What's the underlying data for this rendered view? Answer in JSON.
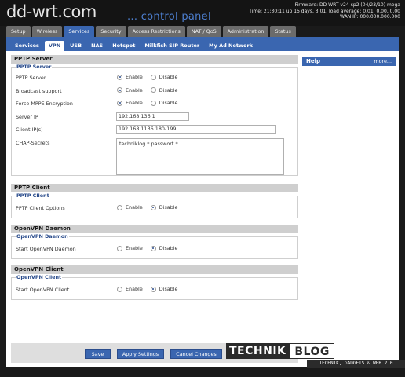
{
  "header": {
    "logo": "dd-wrt.com",
    "panel": "... control panel",
    "firmware": "Firmware: DD-WRT v24-sp2 (04/23/10) mega",
    "time": "Time: 21:30:11 up 15 days, 3:01, load average: 0.01, 0.00, 0.00",
    "wan_ip": "WAN IP: 000.000.000.000"
  },
  "tabs": [
    "Setup",
    "Wireless",
    "Services",
    "Security",
    "Access Restrictions",
    "NAT / QoS",
    "Administration",
    "Status"
  ],
  "subtabs": [
    "Services",
    "VPN",
    "USB",
    "NAS",
    "Hotspot",
    "Milkfish SIP Router",
    "My Ad Network"
  ],
  "options": {
    "enable": "Enable",
    "disable": "Disable"
  },
  "pptp_server": {
    "title": "PPTP Server",
    "legend": "PPTP Server",
    "pptp_server_label": "PPTP Server",
    "broadcast_label": "Broadcast support",
    "mppe_label": "Force MPPE Encryption",
    "server_ip_label": "Server IP",
    "server_ip_value": "192.168.136.1",
    "client_ips_label": "Client IP(s)",
    "client_ips_value": "192.168.1136.180-199",
    "chap_label": "CHAP-Secrets",
    "chap_value": "techniklog * passwort *"
  },
  "pptp_client": {
    "title": "PPTP Client",
    "legend": "PPTP Client",
    "options_label": "PPTP Client Options"
  },
  "openvpn_daemon": {
    "title": "OpenVPN Daemon",
    "legend": "OpenVPN Daemon",
    "start_label": "Start OpenVPN Daemon"
  },
  "openvpn_client": {
    "title": "OpenVPN Client",
    "legend": "OpenVPN Client",
    "start_label": "Start OpenVPN Client"
  },
  "help": {
    "title": "Help",
    "more": "more..."
  },
  "buttons": {
    "save": "Save",
    "apply": "Apply Settings",
    "cancel": "Cancel Changes"
  },
  "watermark": {
    "part1": "TECHNIK",
    "part2": "BLOG",
    "tagline": "TECHNIK, GADGETS & WEB 2.0"
  },
  "colors": {
    "accent": "#3a66b0",
    "tab_inactive": "#6b6b6b",
    "section": "#cfcfcf",
    "legend": "#2a4c8c"
  }
}
